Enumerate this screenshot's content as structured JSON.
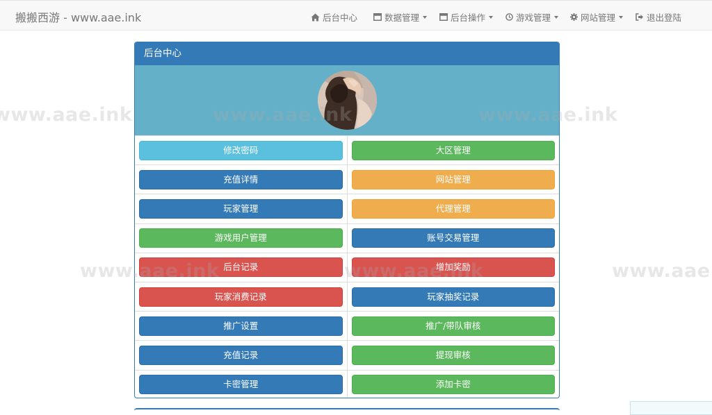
{
  "navbar": {
    "brand": "搬搬西游 - www.aae.ink",
    "items": [
      {
        "icon": "home-icon",
        "label": "后台中心",
        "dropdown": false
      },
      {
        "icon": "window-icon",
        "label": "数据管理",
        "dropdown": true
      },
      {
        "icon": "window-icon",
        "label": "后台操作",
        "dropdown": true
      },
      {
        "icon": "clock-icon",
        "label": "游戏管理",
        "dropdown": true
      },
      {
        "icon": "gear-icon",
        "label": "网站管理",
        "dropdown": true
      },
      {
        "icon": "logout-icon",
        "label": "退出登陆",
        "dropdown": false
      }
    ]
  },
  "watermark": "www.aae.ink",
  "panel": {
    "title": "后台中心",
    "buttons": [
      {
        "label": "修改密码",
        "style": "info"
      },
      {
        "label": "大区管理",
        "style": "success"
      },
      {
        "label": "充值详情",
        "style": "primary"
      },
      {
        "label": "网站管理",
        "style": "warning"
      },
      {
        "label": "玩家管理",
        "style": "primary"
      },
      {
        "label": "代理管理",
        "style": "warning"
      },
      {
        "label": "游戏用户管理",
        "style": "success"
      },
      {
        "label": "账号交易管理",
        "style": "primary"
      },
      {
        "label": "后台记录",
        "style": "danger"
      },
      {
        "label": "增加奖励",
        "style": "danger"
      },
      {
        "label": "玩家消费记录",
        "style": "danger"
      },
      {
        "label": "玩家抽奖记录",
        "style": "primary"
      },
      {
        "label": "推广设置",
        "style": "primary"
      },
      {
        "label": "推广/带队审核",
        "style": "success"
      },
      {
        "label": "充值记录",
        "style": "primary"
      },
      {
        "label": "提现审核",
        "style": "success"
      },
      {
        "label": "卡密管理",
        "style": "primary"
      },
      {
        "label": "添加卡密",
        "style": "success"
      }
    ]
  },
  "colors": {
    "primary": "#337ab7",
    "info": "#5bc0de",
    "success": "#5cb85c",
    "warning": "#f0ad4e",
    "danger": "#d9534f",
    "avatar_bar": "#64b0c9"
  }
}
